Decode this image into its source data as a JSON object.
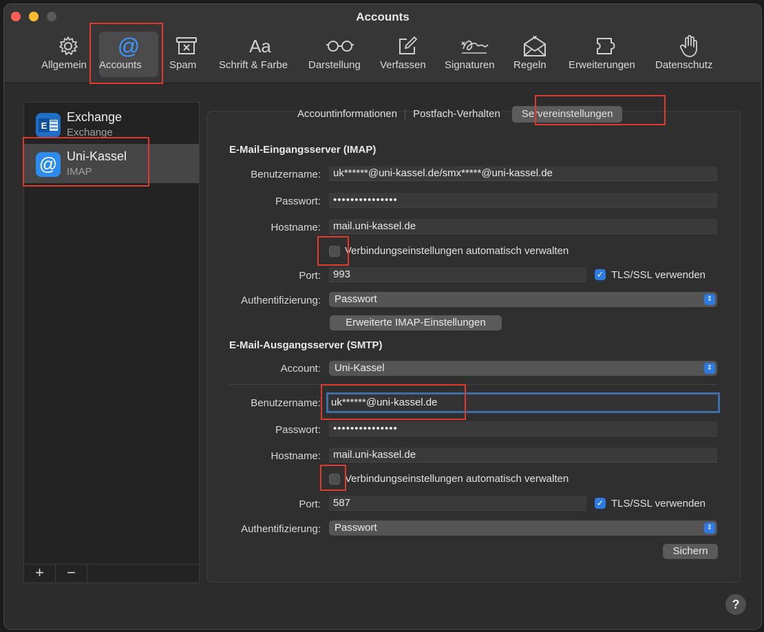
{
  "window": {
    "title": "Accounts"
  },
  "toolbar": {
    "general": "Allgemein",
    "accounts": "Accounts",
    "spam": "Spam",
    "font": "Schrift & Farbe",
    "view": "Darstellung",
    "compose": "Verfassen",
    "signatures": "Signaturen",
    "rules": "Regeln",
    "extensions": "Erweiterungen",
    "privacy": "Datenschutz",
    "font_glyph": "Aa"
  },
  "accounts": [
    {
      "name": "Exchange",
      "type": "Exchange"
    },
    {
      "name": "Uni-Kassel",
      "type": "IMAP"
    }
  ],
  "sidebar": {
    "add": "+",
    "remove": "−"
  },
  "tabs": {
    "info": "Accountinformationen",
    "mailbox": "Postfach-Verhalten",
    "server": "Servereinstellungen"
  },
  "imap": {
    "heading": "E-Mail-Eingangsserver (IMAP)",
    "username_label": "Benutzername:",
    "username": "uk******@uni-kassel.de/smx*****@uni-kassel.de",
    "password_label": "Passwort:",
    "password": "•••••••••••••••",
    "hostname_label": "Hostname:",
    "hostname": "mail.uni-kassel.de",
    "auto_manage": "Verbindungseinstellungen automatisch verwalten",
    "port_label": "Port:",
    "port": "993",
    "tls": "TLS/SSL verwenden",
    "auth_label": "Authentifizierung:",
    "auth": "Passwort",
    "advanced": "Erweiterte IMAP-Einstellungen"
  },
  "smtp": {
    "heading": "E-Mail-Ausgangsserver (SMTP)",
    "account_label": "Account:",
    "account": "Uni-Kassel",
    "username_label": "Benutzername:",
    "username": "uk******@uni-kassel.de",
    "password_label": "Passwort:",
    "password": "•••••••••••••••",
    "hostname_label": "Hostname:",
    "hostname": "mail.uni-kassel.de",
    "auto_manage": "Verbindungseinstellungen automatisch verwalten",
    "port_label": "Port:",
    "port": "587",
    "tls": "TLS/SSL verwenden",
    "auth_label": "Authentifizierung:",
    "auth": "Passwort"
  },
  "save": "Sichern",
  "help": "?",
  "colors": {
    "accent": "#2c7be5",
    "highlight": "#e03a2c",
    "selected_tool": "#3b96ff"
  }
}
